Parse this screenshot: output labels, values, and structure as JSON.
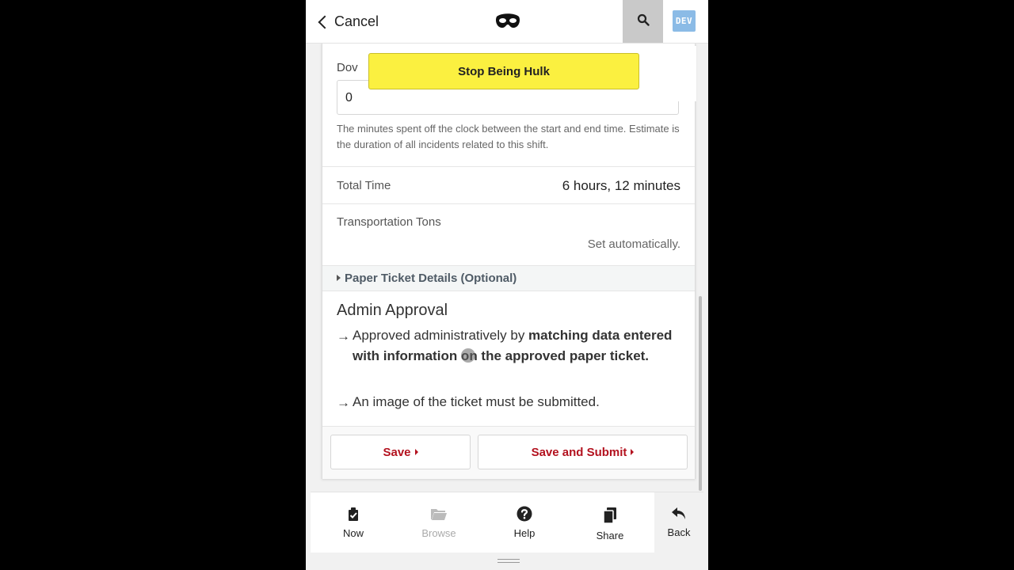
{
  "header": {
    "cancel_label": "Cancel",
    "logo_icon": "mask-icon",
    "search_icon": "search-icon",
    "dev_badge": "DEV"
  },
  "hulk_banner": {
    "label": "Stop Being Hulk"
  },
  "downtime": {
    "label": "Dov",
    "value": "0",
    "hint": "The minutes spent off the clock between the start and end time. Estimate is the duration of all incidents related to this shift."
  },
  "total_time": {
    "label": "Total Time",
    "value": "6 hours, 12 minutes"
  },
  "transportation": {
    "label": "Transportation Tons",
    "value": "Set automatically."
  },
  "paper_ticket": {
    "label": "Paper Ticket Details (Optional)"
  },
  "admin": {
    "title": "Admin Approval",
    "bullet_1_plain": "Approved administratively by ",
    "bullet_1_bold": "matching data entered with information on the approved paper ticket.",
    "bullet_2": "An image of the ticket must be submitted."
  },
  "actions": {
    "save": "Save",
    "save_submit": "Save and Submit"
  },
  "nav": {
    "now": "Now",
    "browse": "Browse",
    "help": "Help",
    "share": "Share",
    "back": "Back"
  },
  "colors": {
    "accent_red": "#b3121f",
    "hulk_yellow": "#fbf040",
    "dev_blue": "#8bbbe6"
  }
}
